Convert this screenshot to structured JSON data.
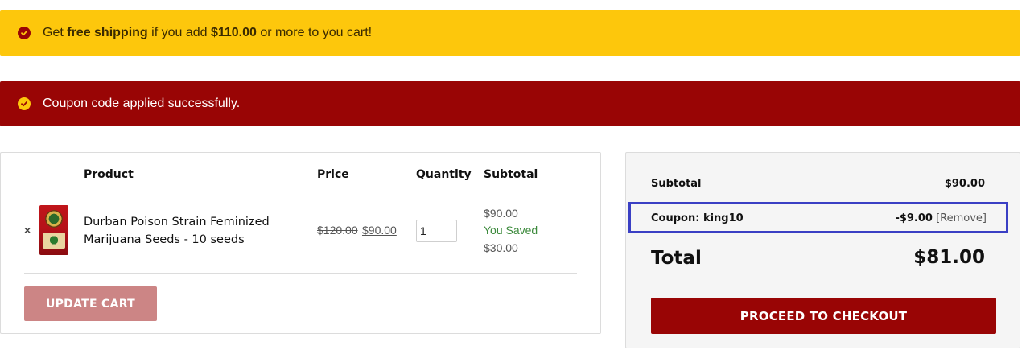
{
  "notices": {
    "shipping": {
      "prefix": "Get ",
      "bold1": "free shipping",
      "middle": " if you add ",
      "bold2": "$110.00",
      "suffix": " or more to you cart!",
      "icon": "check-circle-icon",
      "bg_color": "#fdc70c"
    },
    "coupon": {
      "text": "Coupon code applied successfully.",
      "icon": "check-circle-icon",
      "bg_color": "#990505"
    }
  },
  "cart": {
    "headers": {
      "product": "Product",
      "price": "Price",
      "quantity": "Quantity",
      "subtotal": "Subtotal"
    },
    "items": [
      {
        "remove_symbol": "×",
        "name": "Durban Poison Strain Feminized Marijuana Seeds - 10 seeds",
        "price_original": "$120.00",
        "price_sale": "$90.00",
        "quantity": "1",
        "subtotal": "$90.00",
        "saved_label": "You Saved",
        "saved_amount": "$30.00"
      }
    ],
    "update_button": "UPDATE CART"
  },
  "totals": {
    "subtotal_label": "Subtotal",
    "subtotal_value": "$90.00",
    "coupon_label": "Coupon: king10",
    "coupon_value": "-$9.00",
    "coupon_remove": "[Remove]",
    "total_label": "Total",
    "total_value": "$81.00",
    "checkout_button": "PROCEED TO CHECKOUT"
  },
  "colors": {
    "brand_red": "#990505",
    "brand_yellow": "#fdc70c",
    "highlight_blue": "#3a3fc4",
    "saved_green": "#3c8a3c"
  }
}
